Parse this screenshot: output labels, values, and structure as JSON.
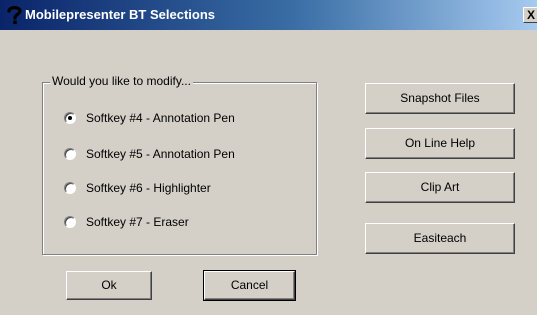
{
  "window": {
    "title": "Mobilepresenter BT Selections",
    "close_label": "X"
  },
  "group": {
    "legend": "Would you like to modify...",
    "options": [
      {
        "label": "Softkey #4 - Annotation Pen",
        "selected": true
      },
      {
        "label": "Softkey #5 - Annotation Pen",
        "selected": false
      },
      {
        "label": "Softkey #6 - Highlighter",
        "selected": false
      },
      {
        "label": "Softkey #7 - Eraser",
        "selected": false
      }
    ]
  },
  "buttons": {
    "snapshot": "Snapshot Files",
    "help": "On Line Help",
    "clipart": "Clip Art",
    "easiteach": "Easiteach",
    "ok": "Ok",
    "cancel": "Cancel"
  },
  "colors": {
    "titlebar_start": "#0a246a",
    "titlebar_end": "#a6caf0",
    "dialog_face": "#d4d0c8"
  }
}
